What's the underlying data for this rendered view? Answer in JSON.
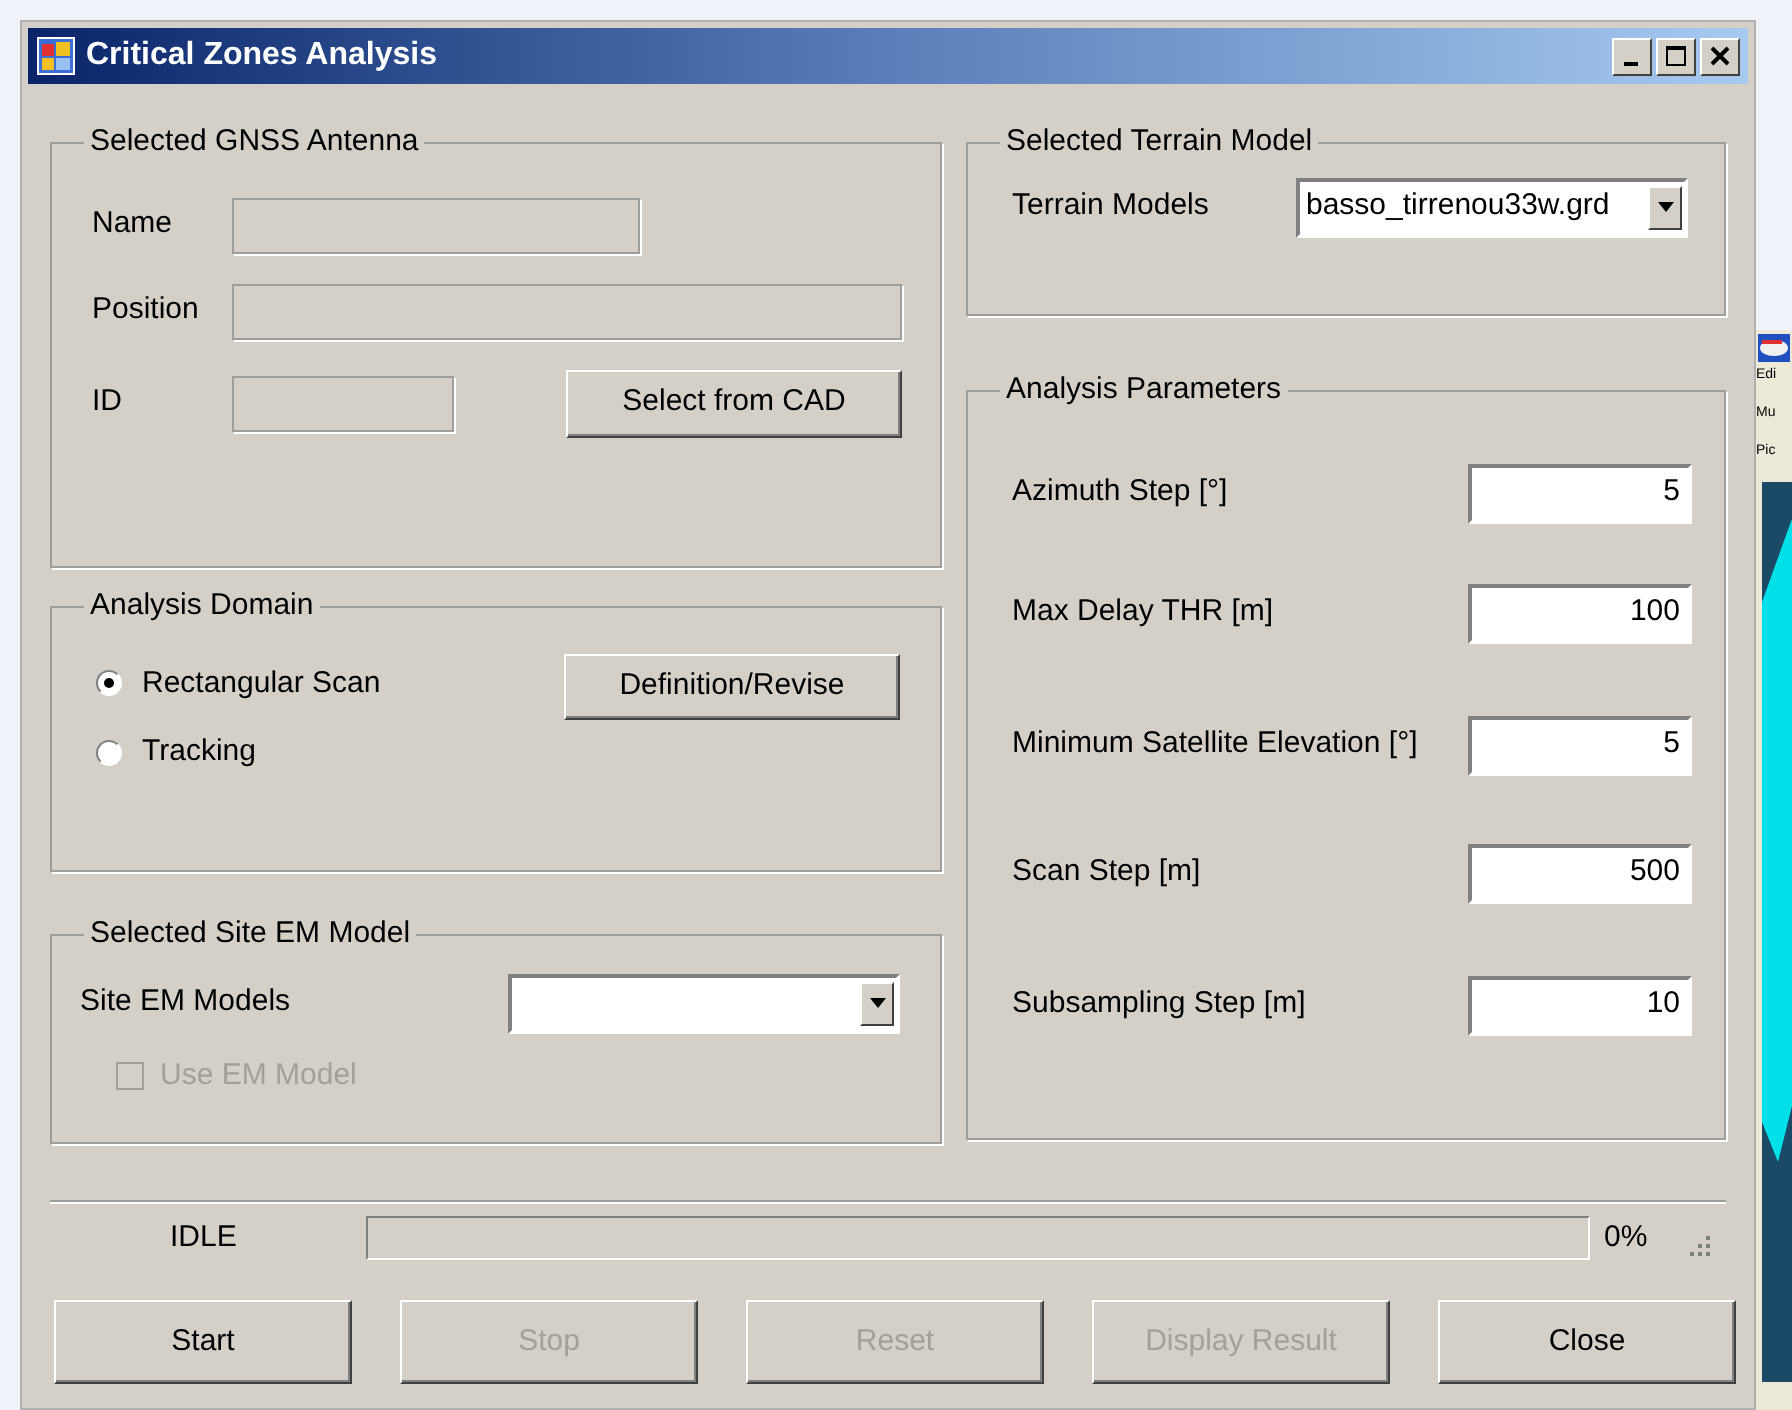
{
  "window": {
    "title": "Critical Zones Analysis"
  },
  "antenna": {
    "title": "Selected GNSS Antenna",
    "fields": [
      {
        "label": "Name"
      },
      {
        "label": "Position"
      },
      {
        "label": "ID"
      }
    ],
    "button": "Select from CAD"
  },
  "domain": {
    "title": "Analysis Domain",
    "options": [
      {
        "label": "Rectangular Scan",
        "selected": true
      },
      {
        "label": "Tracking",
        "selected": false
      }
    ],
    "button": "Definition/Revise"
  },
  "em": {
    "title": "Selected Site EM Model",
    "label": "Site EM Models",
    "checkbox": {
      "label": "Use EM Model",
      "checked": false,
      "disabled": true
    }
  },
  "terrain": {
    "title": "Selected Terrain Model",
    "label": "Terrain Models",
    "value": "basso_tirrenou33w.grd"
  },
  "parameters": {
    "title": "Analysis Parameters",
    "rows": [
      {
        "label": "Azimuth Step [°]",
        "value": "5"
      },
      {
        "label": "Max Delay THR [m]",
        "value": "100"
      },
      {
        "label": "Minimum Satellite Elevation [°]",
        "value": "5"
      },
      {
        "label": "Scan Step [m]",
        "value": "500"
      },
      {
        "label": "Subsampling Step [m]",
        "value": "10"
      }
    ]
  },
  "status": {
    "text": "IDLE",
    "level": 0,
    "percent": "0%"
  },
  "buttons": [
    {
      "label": "Start",
      "disabled": false
    },
    {
      "label": "Stop",
      "disabled": true
    },
    {
      "label": "Reset",
      "disabled": true
    },
    {
      "label": "Display Result",
      "disabled": true
    },
    {
      "label": "Close",
      "disabled": false
    }
  ],
  "background_window": {
    "texts": [
      "Edi",
      "Mu",
      "Pic"
    ]
  }
}
